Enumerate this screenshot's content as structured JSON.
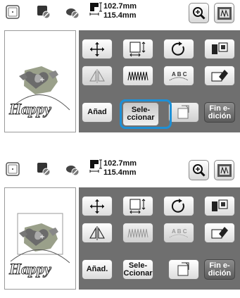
{
  "screens": [
    {
      "dimensions": {
        "width": "102.7mm",
        "height": "115.4mm"
      },
      "buttons": {
        "add_label": "Añad",
        "select_label": "Sele-\nccionar",
        "end_edit_label": "Fin e-\ndición"
      },
      "selected_button": "select",
      "pattern_text": "Happy"
    },
    {
      "dimensions": {
        "width": "102.7mm",
        "height": "115.4mm"
      },
      "buttons": {
        "add_label": "Añad.",
        "select_label": "Sele-\nCcionar",
        "end_edit_label": "Fin e-\ndición"
      },
      "selected_button": "none",
      "pattern_text": "Happy"
    }
  ],
  "colors": {
    "highlight": "#1e90d6",
    "grid_background": "#6f6f6f",
    "button_face": "#dcdcdc"
  },
  "icons": [
    "single-frame-icon",
    "multi-select-icon",
    "group-icon",
    "size-icon",
    "zoom-in-icon",
    "image-view-icon",
    "move-icon",
    "resize-icon",
    "rotate-icon",
    "color-change-icon",
    "mirror-icon",
    "density-icon",
    "array-text-icon",
    "duplicate-icon",
    "border-icon"
  ]
}
